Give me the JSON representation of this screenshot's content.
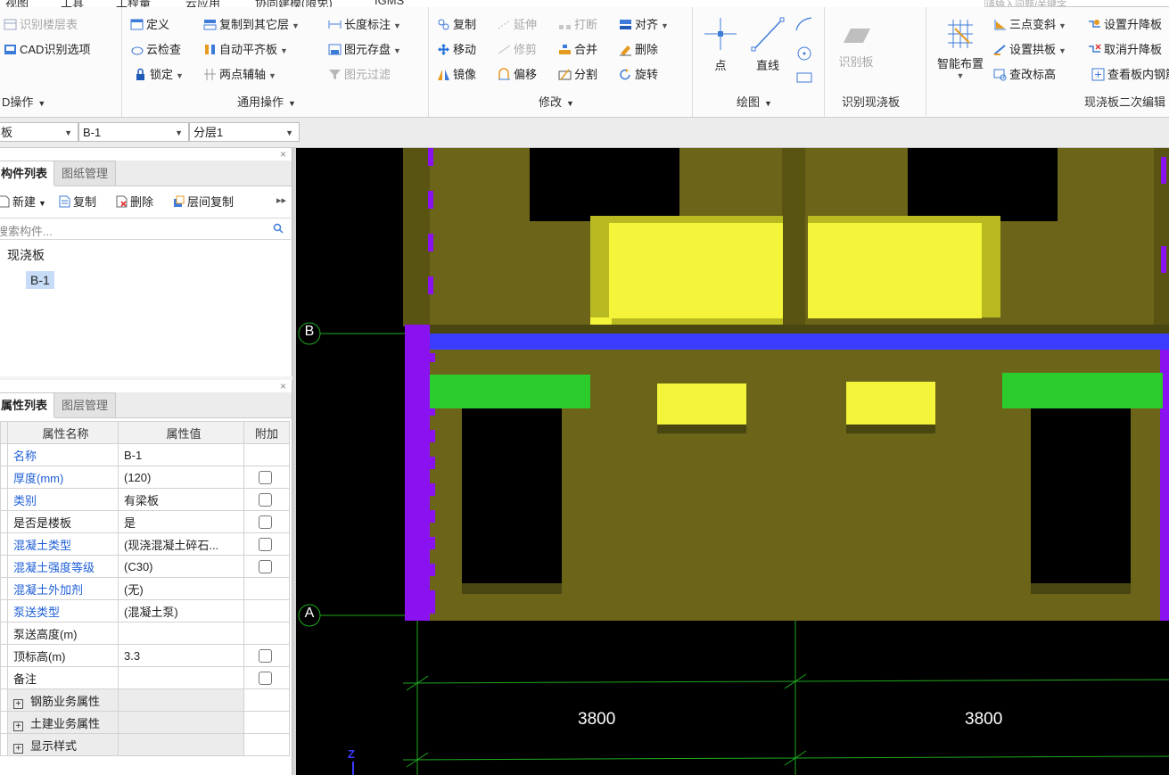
{
  "menubar": {
    "items": [
      "视图",
      "工具",
      "工程量",
      "云应用",
      "协同建模(限免)",
      "IGMS"
    ],
    "search_placeholder": "请输入问题/关键字"
  },
  "ribbon": {
    "cad_group": {
      "btn_identify_layer": "识别楼层表",
      "btn_cad_options": "CAD识别选项",
      "label": "D操作"
    },
    "general_group": {
      "btn_define": "定义",
      "btn_copy_to_layer": "复制到其它层",
      "btn_length_mark": "长度标注",
      "btn_cloud_check": "云检查",
      "btn_auto_align_slab": "自动平齐板",
      "btn_save_element": "图元存盘",
      "btn_lock": "锁定",
      "btn_two_point_axis": "两点辅轴",
      "btn_element_filter": "图元过滤",
      "label": "通用操作"
    },
    "modify_group": {
      "btn_copy": "复制",
      "btn_extend": "延伸",
      "btn_break": "打断",
      "btn_align": "对齐",
      "btn_move": "移动",
      "btn_trim": "修剪",
      "btn_merge": "合并",
      "btn_delete": "删除",
      "btn_mirror": "镜像",
      "btn_offset": "偏移",
      "btn_split": "分割",
      "btn_rotate": "旋转",
      "label": "修改"
    },
    "draw_group": {
      "btn_point": "点",
      "btn_line": "直线",
      "label": "绘图"
    },
    "identify_slab_group": {
      "btn_identify_slab": "识别板",
      "label": "识别现浇板"
    },
    "slab_edit_group": {
      "btn_smart_layout": "智能布置",
      "btn_three_point_slope": "三点变斜",
      "btn_set_arch": "设置拱板",
      "btn_modify_elev": "查改标高",
      "btn_set_raise": "设置升降板",
      "btn_cancel_raise": "取消升降板",
      "btn_view_slab": "查看板内钢筋",
      "label": "现浇板二次编辑"
    }
  },
  "selectors": {
    "type": "板",
    "component": "B-1",
    "sublayer": "分层1"
  },
  "component_panel": {
    "tab_active": "构件列表",
    "tab_other": "图纸管理",
    "btn_new": "新建",
    "btn_copy": "复制",
    "btn_delete": "删除",
    "btn_layer_copy": "层间复制",
    "search_placeholder": "搜索构件...",
    "tree": {
      "category": "现浇板",
      "item": "B-1"
    }
  },
  "property_panel": {
    "tab_active": "属性列表",
    "tab_other": "图层管理",
    "headers": [
      "属性名称",
      "属性值",
      "附加"
    ],
    "rows": [
      {
        "name": "名称",
        "value": "B-1",
        "blue": true,
        "check": false
      },
      {
        "name": "厚度(mm)",
        "value": "(120)",
        "blue": true,
        "check": true
      },
      {
        "name": "类别",
        "value": "有梁板",
        "blue": true,
        "check": true
      },
      {
        "name": "是否是楼板",
        "value": "是",
        "blue": false,
        "check": true
      },
      {
        "name": "混凝土类型",
        "value": "(现浇混凝土碎石...",
        "blue": true,
        "check": true
      },
      {
        "name": "混凝土强度等级",
        "value": "(C30)",
        "blue": true,
        "check": true
      },
      {
        "name": "混凝土外加剂",
        "value": "(无)",
        "blue": true,
        "check": false
      },
      {
        "name": "泵送类型",
        "value": "(混凝土泵)",
        "blue": true,
        "check": false
      },
      {
        "name": "泵送高度(m)",
        "value": "",
        "blue": false,
        "check": false
      },
      {
        "name": "顶标高(m)",
        "value": "3.3",
        "blue": false,
        "check": true
      },
      {
        "name": "备注",
        "value": "",
        "blue": false,
        "check": true
      }
    ],
    "groups": [
      "钢筋业务属性",
      "土建业务属性",
      "显示样式"
    ]
  },
  "canvas": {
    "axis_b": "B",
    "axis_a": "A",
    "dim_1": "3800",
    "dim_2": "3800",
    "z_label": "Z",
    "colors": {
      "slab": "#6b6419",
      "highlight": "#f4f43a",
      "beam_blue": "#3c3cff",
      "beam_purple": "#8a11f0",
      "green": "#2ccc2c",
      "grid": "#1faa1f"
    }
  }
}
